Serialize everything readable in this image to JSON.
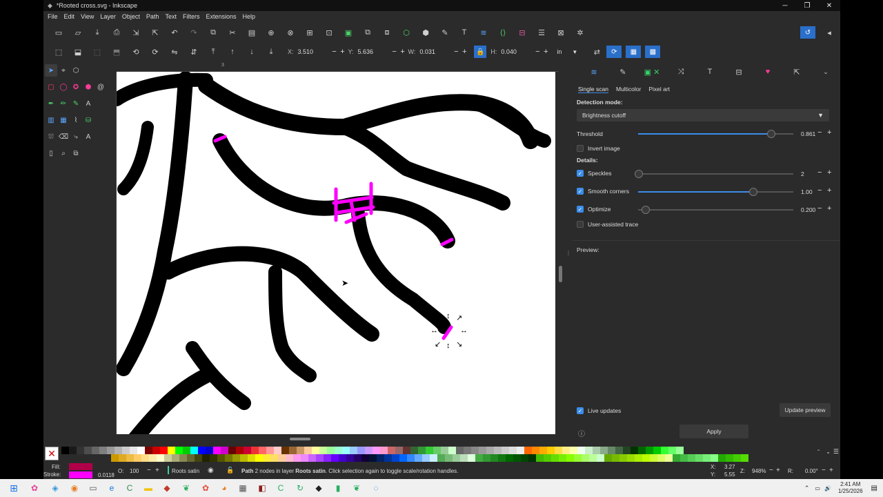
{
  "window": {
    "title": "*Rooted cross.svg - Inkscape",
    "minimize": "─",
    "maximize": "❐",
    "close": "✕"
  },
  "menu": [
    "File",
    "Edit",
    "View",
    "Layer",
    "Object",
    "Path",
    "Text",
    "Filters",
    "Extensions",
    "Help"
  ],
  "controls": {
    "x_label": "X:",
    "x_value": "3.510",
    "y_label": "Y:",
    "y_value": "5.636",
    "w_label": "W:",
    "w_value": "0.031",
    "h_label": "H:",
    "h_value": "0.040",
    "unit": "in"
  },
  "ruler": {
    "top_mark": "3"
  },
  "panel": {
    "subtabs": [
      "Single scan",
      "Multicolor",
      "Pixel art"
    ],
    "detection_label": "Detection mode:",
    "detection_value": "Brightness cutoff",
    "threshold_label": "Threshold",
    "threshold_value": "0.861",
    "threshold_level": 0.861,
    "invert_label": "Invert image",
    "details_label": "Details:",
    "speckles_label": "Speckles",
    "speckles_value": "2",
    "smooth_label": "Smooth corners",
    "smooth_value": "1.00",
    "optimize_label": "Optimize",
    "optimize_value": "0.200",
    "user_assisted_label": "User-assisted trace",
    "preview_label": "Preview:",
    "live_updates_label": "Live updates",
    "update_preview_label": "Update preview",
    "apply_label": "Apply"
  },
  "status": {
    "fill_label": "Fill:",
    "stroke_label": "Stroke:",
    "stroke_width": "0.0118",
    "opacity_label": "O:",
    "opacity_value": "100",
    "layer_name": "Roots satin",
    "message_bold": "Path",
    "message_pre": " 2 nodes in layer ",
    "message_layer": "Roots satin",
    "message_post": ". Click selection again to toggle scale/rotation handles.",
    "x_label": "X:",
    "x_value": "3.27",
    "y_label": "Y:",
    "y_value": "5.55",
    "zoom_label": "Z:",
    "zoom_value": "948%",
    "rot_label": "R:",
    "rot_value": "0.00°"
  },
  "taskbar": {
    "time": "2:41 AM",
    "date": "1/25/2026"
  },
  "colors": {
    "accent": "#3b8eea",
    "magenta": "#ff00ff",
    "fill_swatch": "#b0004a",
    "stroke_swatch": "#ff00ff"
  }
}
